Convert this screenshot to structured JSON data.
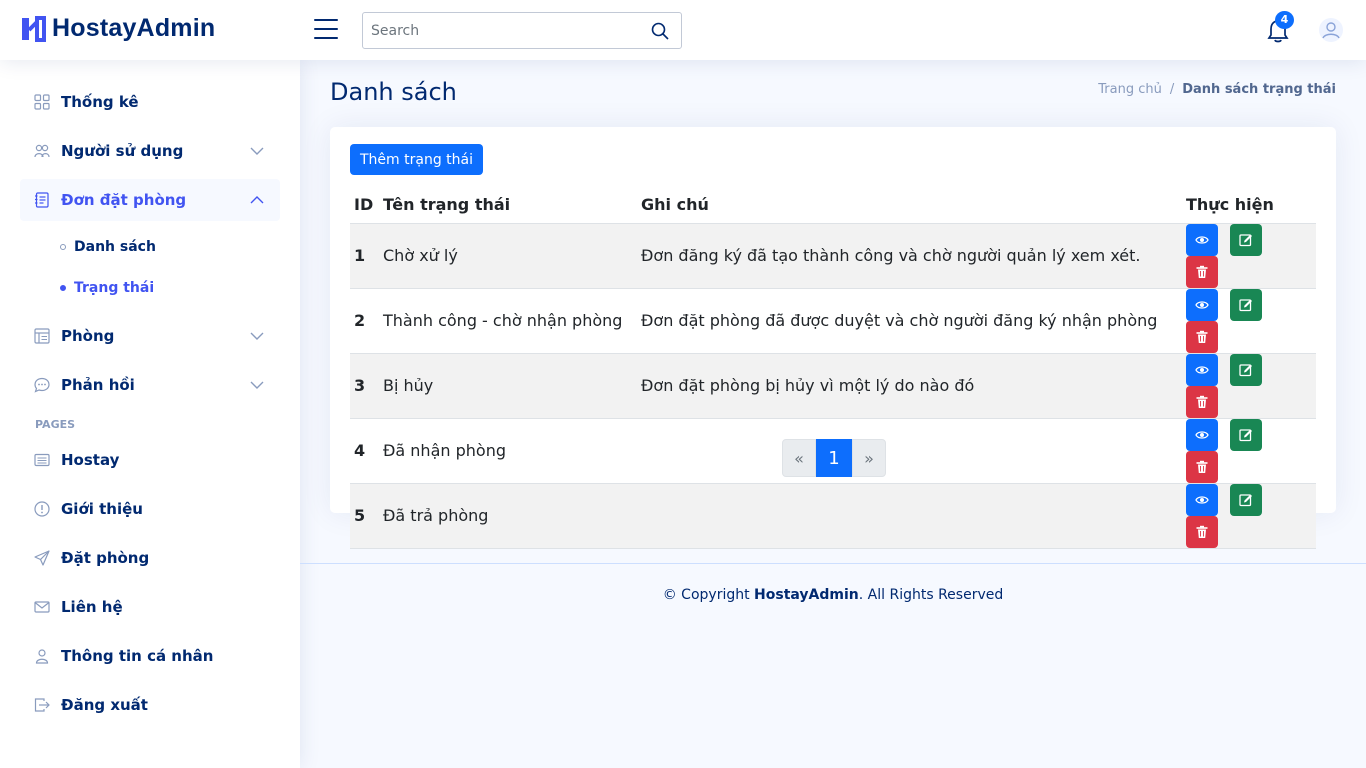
{
  "app": {
    "brand": "HostayAdmin"
  },
  "header": {
    "search_placeholder": "Search",
    "notifications_count": "4"
  },
  "sidebar": {
    "items": [
      {
        "label": "Thống kê"
      },
      {
        "label": "Người sử dụng"
      },
      {
        "label": "Đơn đặt phòng"
      },
      {
        "label": "Phòng"
      },
      {
        "label": "Phản hồi"
      }
    ],
    "sub_items": [
      {
        "label": "Danh sách"
      },
      {
        "label": "Trạng thái"
      }
    ],
    "heading": "PAGES",
    "pages": [
      {
        "label": "Hostay"
      },
      {
        "label": "Giới thiệu"
      },
      {
        "label": "Đặt phòng"
      },
      {
        "label": "Liên hệ"
      },
      {
        "label": "Thông tin cá nhân"
      },
      {
        "label": "Đăng xuất"
      }
    ]
  },
  "page": {
    "title": "Danh sách",
    "breadcrumb": {
      "home": "Trang chủ",
      "separator": "/",
      "current": "Danh sách trạng thái"
    }
  },
  "card": {
    "add_button": "Thêm trạng thái",
    "table": {
      "headers": {
        "id": "ID",
        "name": "Tên trạng thái",
        "note": "Ghi chú",
        "actions": "Thực hiện"
      },
      "rows": [
        {
          "id": "1",
          "name": "Chờ xử lý",
          "note": "Đơn đăng ký đã tạo thành công và chờ người quản lý xem xét."
        },
        {
          "id": "2",
          "name": "Thành công - chờ nhận phòng",
          "note": "Đơn đặt phòng đã được duyệt và chờ người đăng ký nhận phòng"
        },
        {
          "id": "3",
          "name": "Bị hủy",
          "note": "Đơn đặt phòng bị hủy vì một lý do nào đó"
        },
        {
          "id": "4",
          "name": "Đã nhận phòng",
          "note": ""
        },
        {
          "id": "5",
          "name": "Đã trả phòng",
          "note": ""
        }
      ]
    },
    "pagination": {
      "prev": "«",
      "current": "1",
      "next": "»"
    }
  },
  "footer": {
    "prefix": "© Copyright ",
    "brand": "HostayAdmin",
    "suffix": ". All Rights Reserved"
  },
  "colors": {
    "primary": "#0d6efd",
    "success": "#198754",
    "danger": "#dc3545",
    "navy": "#012970",
    "accent": "#4154f1"
  }
}
